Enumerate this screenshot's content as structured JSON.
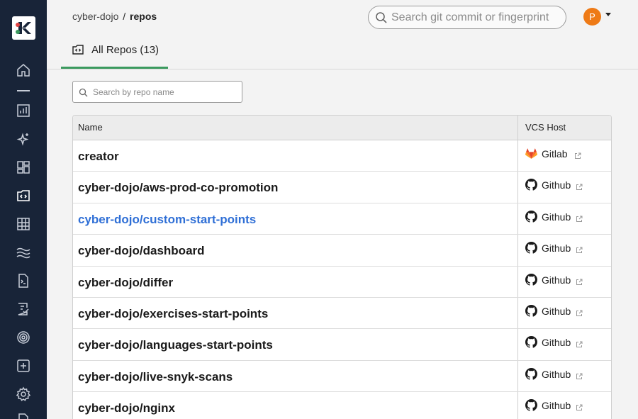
{
  "breadcrumb": {
    "org": "cyber-dojo",
    "separator": "/",
    "current": "repos"
  },
  "global_search": {
    "placeholder": "Search git commit or fingerprint"
  },
  "user": {
    "initial": "P",
    "avatar_color": "#ee7a16"
  },
  "tab": {
    "label": "All Repos (13)"
  },
  "repo_search": {
    "placeholder": "Search by repo name"
  },
  "table": {
    "columns": [
      "Name",
      "VCS Host"
    ],
    "rows": [
      {
        "name": "creator",
        "host": "Gitlab",
        "host_icon": "gitlab-icon",
        "highlighted": false
      },
      {
        "name": "cyber-dojo/aws-prod-co-promotion",
        "host": "Github",
        "host_icon": "github-icon",
        "highlighted": false
      },
      {
        "name": "cyber-dojo/custom-start-points",
        "host": "Github",
        "host_icon": "github-icon",
        "highlighted": true
      },
      {
        "name": "cyber-dojo/dashboard",
        "host": "Github",
        "host_icon": "github-icon",
        "highlighted": false
      },
      {
        "name": "cyber-dojo/differ",
        "host": "Github",
        "host_icon": "github-icon",
        "highlighted": false
      },
      {
        "name": "cyber-dojo/exercises-start-points",
        "host": "Github",
        "host_icon": "github-icon",
        "highlighted": false
      },
      {
        "name": "cyber-dojo/languages-start-points",
        "host": "Github",
        "host_icon": "github-icon",
        "highlighted": false
      },
      {
        "name": "cyber-dojo/live-snyk-scans",
        "host": "Github",
        "host_icon": "github-icon",
        "highlighted": false
      },
      {
        "name": "cyber-dojo/nginx",
        "host": "Github",
        "host_icon": "github-icon",
        "highlighted": false
      }
    ]
  },
  "sidebar": {
    "icons": [
      "logo-icon",
      "home-icon",
      "analytics-icon",
      "sparkle-icon",
      "dashboard-icon",
      "repos-icon",
      "grid-icon",
      "flows-icon",
      "terminal-file-icon",
      "checklist-icon",
      "target-icon",
      "plus-square-icon",
      "settings-icon"
    ]
  },
  "colors": {
    "sidebar": "#182438",
    "accent": "#3b9a5e",
    "link": "#2f6fd6"
  }
}
